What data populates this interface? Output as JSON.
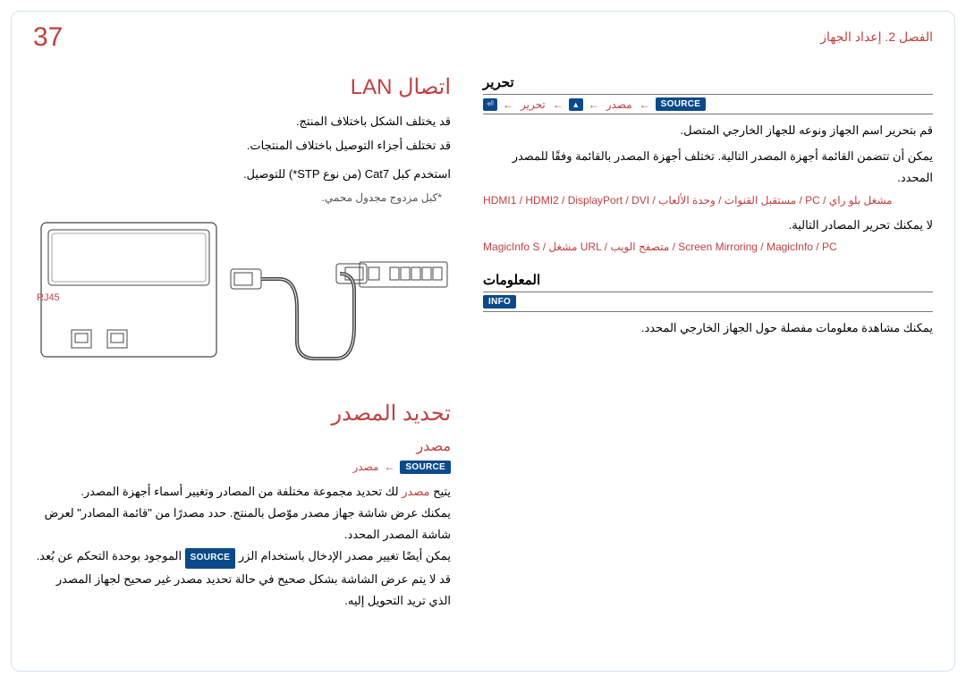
{
  "page_number": "37",
  "chapter": "الفصل 2. إعداد الجهاز",
  "tags": {
    "source": "SOURCE",
    "info": "INFO"
  },
  "lan": {
    "heading": "اتصال LAN",
    "line1": "قد يختلف الشكل باختلاف المنتج.",
    "line2": "قد تختلف أجزاء التوصيل باختلاف المنتجات.",
    "line3_a": "استخدم كبل Cat7 (من نوع STP*) للتوصيل.",
    "line3_b": "*كبل مزدوج مجدول محمي.",
    "rj45": "RJ45"
  },
  "source_sel": {
    "heading": "تحديد المصدر",
    "sub": "مصدر",
    "path_masdar": "مصدر",
    "p1_a": "يتيح ",
    "p1_b": "مصدر",
    "p1_c": " لك تحديد مجموعة مختلفة من المصادر وتغيير أسماء أجهزة المصدر.",
    "p2": "يمكنك عرض شاشة جهاز مصدر موّصل بالمنتج. حدد مصدرًا من \"قائمة المصادر\" لعرض شاشة المصدر المحدد.",
    "p3_a": "يمكن أيضًا تغيير مصدر الإدخال باستخدام الزر ",
    "p3_b": " الموجود بوحدة التحكم عن بُعد.",
    "p4": "قد لا يتم عرض الشاشة بشكل صحيح في حالة تحديد مصدر غير صحيح لجهاز المصدر الذي تريد التحويل إليه."
  },
  "edit": {
    "heading": "تحرير",
    "path_masdar": "مصدر",
    "path_tahrir": "تحرير",
    "p1": "قم بتحرير اسم الجهاز ونوعه للجهاز الخارجي المتصل.",
    "p2": "يمكن أن تتضمن القائمة أجهزة المصدر التالية. تختلف أجهزة المصدر بالقائمة وفقًا للمصدر المحدد.",
    "src_line1": "HDMI1 / HDMI2 / DisplayPort / DVI / مستقبل القنوات / وحدة الألعاب / PC / مشغل بلو راي",
    "p3": "لا يمكنك تحرير المصادر التالية.",
    "src_line2": "MagicInfo S / مشغل URL / متصفح الويب / Screen Mirroring / MagicInfo / PC"
  },
  "info": {
    "heading": "المعلومات",
    "p1": "يمكنك مشاهدة معلومات مفصلة حول الجهاز الخارجي المحدد."
  }
}
